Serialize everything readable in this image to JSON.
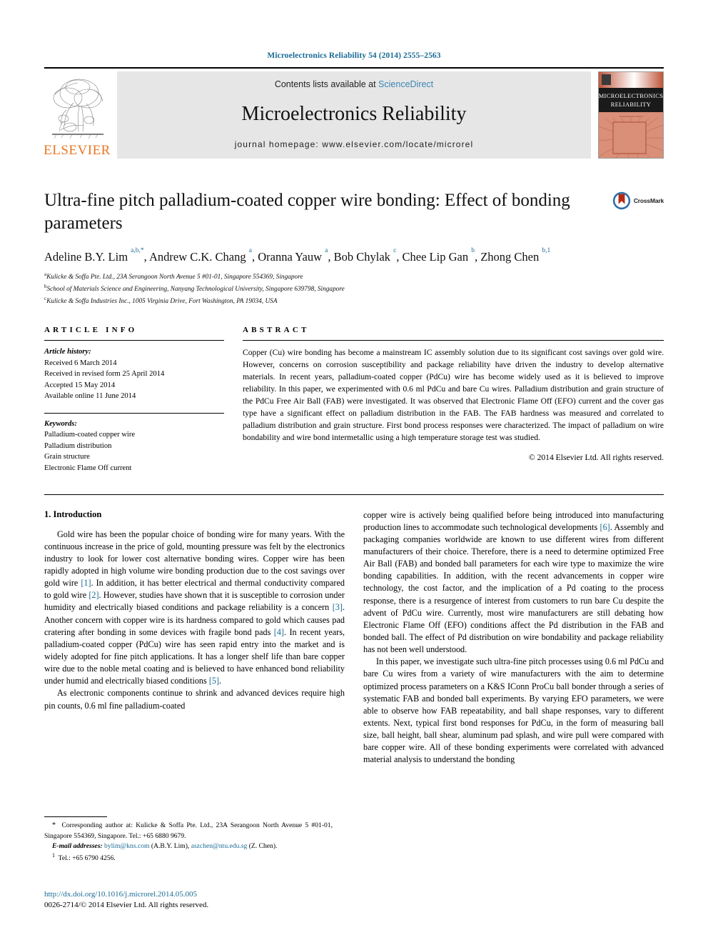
{
  "running_head": "Microelectronics Reliability 54 (2014) 2555–2563",
  "banner": {
    "contents_prefix": "Contents lists available at ",
    "sciencedirect": "ScienceDirect",
    "journal_name": "Microelectronics Reliability",
    "homepage": "journal homepage: www.elsevier.com/locate/microrel",
    "publisher": "ELSEVIER",
    "cover_line1": "MICROELECTRONICS",
    "cover_line2": "RELIABILITY",
    "accent_orange": "#e87722",
    "link_blue": "#3a86b5"
  },
  "crossmark": {
    "label": "CrossMark"
  },
  "title": "Ultra-fine pitch palladium-coated copper wire bonding: Effect of bonding parameters",
  "authors_html": "Adeline B.Y. Lim <sup>a,b,</sup><sup>*</sup>, Andrew C.K. Chang <sup>a</sup>, Oranna Yauw <sup>a</sup>, Bob Chylak <sup>c</sup>, Chee Lip Gan <sup>b</sup>, Zhong Chen <sup>b,1</sup>",
  "affiliations": [
    {
      "mark": "a",
      "text": "Kulicke & Soffa Pte. Ltd., 23A Serangoon North Avenue 5 #01-01, Singapore 554369, Singapore"
    },
    {
      "mark": "b",
      "text": "School of Materials Science and Engineering, Nanyang Technological University, Singapore 639798, Singapore"
    },
    {
      "mark": "c",
      "text": "Kulicke & Soffa Industries Inc., 1005 Virginia Drive, Fort Washington, PA 19034, USA"
    }
  ],
  "article_info": {
    "heading": "ARTICLE INFO",
    "history_title": "Article history:",
    "history": [
      "Received 6 March 2014",
      "Received in revised form 25 April 2014",
      "Accepted 15 May 2014",
      "Available online 11 June 2014"
    ],
    "keywords_title": "Keywords:",
    "keywords": [
      "Palladium-coated copper wire",
      "Palladium distribution",
      "Grain structure",
      "Electronic Flame Off current"
    ]
  },
  "abstract": {
    "heading": "ABSTRACT",
    "text": "Copper (Cu) wire bonding has become a mainstream IC assembly solution due to its significant cost savings over gold wire. However, concerns on corrosion susceptibility and package reliability have driven the industry to develop alternative materials. In recent years, palladium-coated copper (PdCu) wire has become widely used as it is believed to improve reliability. In this paper, we experimented with 0.6 ml PdCu and bare Cu wires. Palladium distribution and grain structure of the PdCu Free Air Ball (FAB) were investigated. It was observed that Electronic Flame Off (EFO) current and the cover gas type have a significant effect on palladium distribution in the FAB. The FAB hardness was measured and correlated to palladium distribution and grain structure. First bond process responses were characterized. The impact of palladium on wire bondability and wire bond intermetallic using a high temperature storage test was studied.",
    "copyright": "© 2014 Elsevier Ltd. All rights reserved."
  },
  "body": {
    "section_heading": "1. Introduction",
    "left_paragraphs_html": [
      "Gold wire has been the popular choice of bonding wire for many years. With the continuous increase in the price of gold, mounting pressure was felt by the electronics industry to look for lower cost alternative bonding wires. Copper wire has been rapidly adopted in high volume wire bonding production due to the cost savings over gold wire <span class=\"ref\">[1]</span>. In addition, it has better electrical and thermal conductivity compared to gold wire <span class=\"ref\">[2]</span>. However, studies have shown that it is susceptible to corrosion under humidity and electrically biased conditions and package reliability is a concern <span class=\"ref\">[3]</span>. Another concern with copper wire is its hardness compared to gold which causes pad cratering after bonding in some devices with fragile bond pads <span class=\"ref\">[4]</span>. In recent years, palladium-coated copper (PdCu) wire has seen rapid entry into the market and is widely adopted for fine pitch applications. It has a longer shelf life than bare copper wire due to the noble metal coating and is believed to have enhanced bond reliability under humid and electrically biased conditions <span class=\"ref\">[5]</span>.",
      "As electronic components continue to shrink and advanced devices require high pin counts, 0.6 ml fine palladium-coated"
    ],
    "right_paragraphs_html": [
      "copper wire is actively being qualified before being introduced into manufacturing production lines to accommodate such technological developments <span class=\"ref\">[6]</span>. Assembly and packaging companies worldwide are known to use different wires from different manufacturers of their choice. Therefore, there is a need to determine optimized Free Air Ball (FAB) and bonded ball parameters for each wire type to maximize the wire bonding capabilities. In addition, with the recent advancements in copper wire technology, the cost factor, and the implication of a Pd coating to the process response, there is a resurgence of interest from customers to run bare Cu despite the advent of PdCu wire. Currently, most wire manufacturers are still debating how Electronic Flame Off (EFO) conditions affect the Pd distribution in the FAB and bonded ball. The effect of Pd distribution on wire bondability and package reliability has not been well understood.",
      "In this paper, we investigate such ultra-fine pitch processes using 0.6 ml PdCu and bare Cu wires from a variety of wire manufacturers with the aim to determine optimized process parameters on a K&S IConn ProCu ball bonder through a series of systematic FAB and bonded ball experiments. By varying EFO parameters, we were able to observe how FAB repeatability, and ball shape responses, vary to different extents. Next, typical first bond responses for PdCu, in the form of measuring ball size, ball height, ball shear, aluminum pad splash, and wire pull were compared with bare copper wire. All of these bonding experiments were correlated with advanced material analysis to understand the bonding"
    ]
  },
  "footnotes": {
    "corresponding_html": "<span class=\"star\">*</span>&nbsp; Corresponding author at: Kulicke & Soffa Pte. Ltd., 23A Serangoon North Avenue 5 #01-01, Singapore 554369, Singapore. Tel.: +65 6880 9679.",
    "emails_html": "<span class=\"fn-em\">E-mail addresses:</span> <span class=\"link\">bylim@kns.com</span> (A.B.Y. Lim), <span class=\"link\">aszchen@ntu.edu.sg</span> (Z. Chen).",
    "tel_html": "<sup>1</sup>&nbsp; Tel.: +65 6790 4256."
  },
  "doi": "http://dx.doi.org/10.1016/j.microrel.2014.05.005",
  "issn_line": "0026-2714/© 2014 Elsevier Ltd. All rights reserved."
}
